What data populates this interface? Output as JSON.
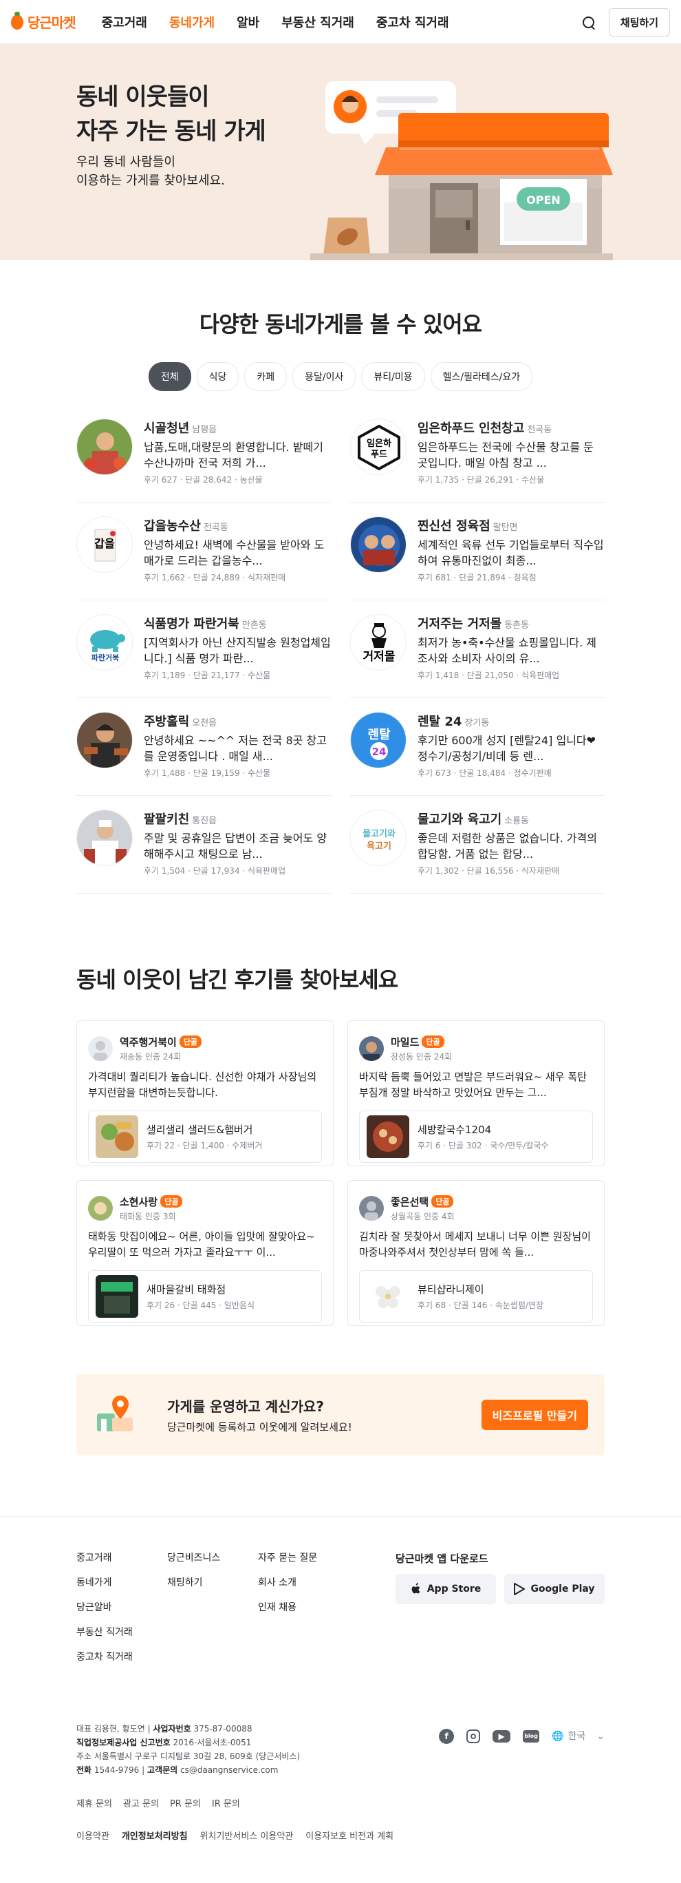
{
  "nav": {
    "logo": "당근마켓",
    "items": [
      "중고거래",
      "동네가게",
      "알바",
      "부동산 직거래",
      "중고차 직거래"
    ],
    "active_index": 1,
    "chat_label": "채팅하기"
  },
  "hero": {
    "title_line1": "동네 이웃들이",
    "title_line2": "자주 가는 동네 가게",
    "sub_line1": "우리 동네 사람들이",
    "sub_line2": "이용하는 가게를 찾아보세요.",
    "sign": "OPEN"
  },
  "stores_section": {
    "title": "다양한 동네가게를 볼 수 있어요",
    "chips": [
      "전체",
      "식당",
      "카페",
      "용달/이사",
      "뷰티/미용",
      "헬스/필라테스/요가"
    ],
    "stores": [
      {
        "name": "시골청년",
        "area": "남평읍",
        "desc": "납품,도매,대량문의 환영합니다. 밭떼기 수산나까마 전국 저희 가...",
        "meta": "후기 627 · 단골 28,642 · 농산물"
      },
      {
        "name": "임은하푸드 인천창고",
        "area": "천곡동",
        "desc": "임은하푸드는 전국에 수산물 창고를 둔 곳입니다. 매일 아침 창고 ...",
        "meta": "후기 1,735 · 단골 26,291 · 수산물"
      },
      {
        "name": "갑을농수산",
        "area": "전곡동",
        "desc": "안녕하세요! 새벽에 수산물을 받아와 도매가로 드리는 갑을농수...",
        "meta": "후기 1,662 · 단골 24,889 · 식자재판매"
      },
      {
        "name": "찐신선 정육점",
        "area": "팔탄면",
        "desc": "세계적인 육류 선두 기업들로부터 직수입하여 유통마진없이 최종...",
        "meta": "후기 681 · 단골 21,894 · 정육점"
      },
      {
        "name": "식품명가 파란거북",
        "area": "만촌동",
        "desc": "[지역회사가 아닌 산지직발송 원청업체입니다.] 식품 명가 파란...",
        "meta": "후기 1,189 · 단골 21,177 · 수산물"
      },
      {
        "name": "거저주는 거저몰",
        "area": "동촌동",
        "desc": "최저가 농•축•수산물 쇼핑몰입니다. 제조사와 소비자 사이의 유...",
        "meta": "후기 1,418 · 단골 21,050 · 식육판매업"
      },
      {
        "name": "주방홀릭",
        "area": "오천읍",
        "desc": "안녕하세요 ~~^^ 저는 전국 8곳 창고를 운영중입니다 . 매일 새...",
        "meta": "후기 1,488 · 단골 19,159 · 수산물"
      },
      {
        "name": "렌탈 24",
        "area": "장기동",
        "desc": "후기만 600개 성지 [렌탈24] 입니다❤ 정수기/공청기/비데 등 렌...",
        "meta": "후기 673 · 단골 18,484 · 정수기판매"
      },
      {
        "name": "팔팔키친",
        "area": "통진읍",
        "desc": "주말 및 공휴일은 답변이 조금 늦어도 양해해주시고 채팅으로 남...",
        "meta": "후기 1,504 · 단골 17,934 · 식육판매업"
      },
      {
        "name": "물고기와 육고기",
        "area": "소룡동",
        "desc": "좋은데 저렴한 상품은 없습니다. 가격의 합당함. 거품 없는 합당...",
        "meta": "후기 1,302 · 단골 16,556 · 식자재판매"
      }
    ],
    "logo_texts": [
      "임은하\n푸드",
      "갑을",
      "파란거북",
      "거저몰",
      "렌탈",
      "24",
      "물고기와\n육고기"
    ]
  },
  "reviews_section": {
    "title": "동네 이웃이 남긴 후기를 찾아보세요",
    "badge": "단골",
    "reviews": [
      {
        "user": "역주행거북이",
        "loc": "재송동 인증 24회",
        "text": "가격대비 퀄리티가 높습니다. 신선한 야채가 사장님의 부지런함을 대변하는듯합니다.",
        "store": "샐리샐리 샐러드&햄버거",
        "meta": "후기 22 · 단골 1,400 · 수제버거"
      },
      {
        "user": "마일드",
        "loc": "장성동 인증 24회",
        "text": "바지락 듬뿍 들어있고 면발은 부드러워요~ 새우 폭탄부침개 정말 바삭하고 맛있어요 만두는 그...",
        "store": "세방칼국수1204",
        "meta": "후기 6 · 단골 302 · 국수/만두/칼국수"
      },
      {
        "user": "소현사랑",
        "loc": "태화동 인증 3회",
        "text": "태화동 맛집이에요~ 어른, 아이들 입맛에 잘맞아요~ 우리딸이 또 먹으러 가자고 졸라요ㅜㅜ 이...",
        "store": "새마을갈비 태화점",
        "meta": "후기 26 · 단골 445 · 일반음식"
      },
      {
        "user": "좋은선택",
        "loc": "상월곡동 인증 4회",
        "text": "김치라 잘 못찾아서 메세지 보내니 너무 이쁜 원장님이 마중나와주셔서 첫인상부터 맘에 쏙 들...",
        "store": "뷰티샵라니제이",
        "meta": "후기 68 · 단골 146 · 속눈썹펌/연장"
      }
    ]
  },
  "banner": {
    "title": "가게를 운영하고 계신가요?",
    "sub": "당근마켓에 등록하고 이웃에게 알려보세요!",
    "button": "비즈프로필 만들기"
  },
  "footer": {
    "col1": [
      "중고거래",
      "동네가게",
      "당근알바",
      "부동산 직거래",
      "중고차 직거래"
    ],
    "col2": [
      "당근비즈니스",
      "채팅하기"
    ],
    "col3": [
      "자주 묻는 질문",
      "회사 소개",
      "인재 채용"
    ],
    "app_title": "당근마켓 앱 다운로드",
    "appstore": "App Store",
    "googleplay": "Google Play",
    "info_line1_a": "대표 김용현, 황도연 ",
    "info_line1_b": "사업자번호",
    "info_line1_c": " 375-87-00088",
    "info_line2_a": "직업정보제공사업 신고번호",
    "info_line2_b": " 2016-서울서초-0051",
    "info_line3": "주소 서울특별시 구로구 디지털로 30길 28, 609호 (당근서비스)",
    "info_line4_a": "전화",
    "info_line4_b": " 1544-9796 | ",
    "info_line4_c": "고객문의",
    "info_line4_d": " cs@daangnservice.com",
    "lang": "한국",
    "links1": [
      "제휴 문의",
      "광고 문의",
      "PR 문의",
      "IR 문의"
    ],
    "links2": [
      "이용약관",
      "개인정보처리방침",
      "위치기반서비스 이용약관",
      "이용자보호 비전과 계획"
    ],
    "social_blog": "blog"
  },
  "colors": {
    "brand": "#ff6f0f",
    "hero_bg": "#f7ebe1",
    "banner_bg": "#fff4ea"
  }
}
